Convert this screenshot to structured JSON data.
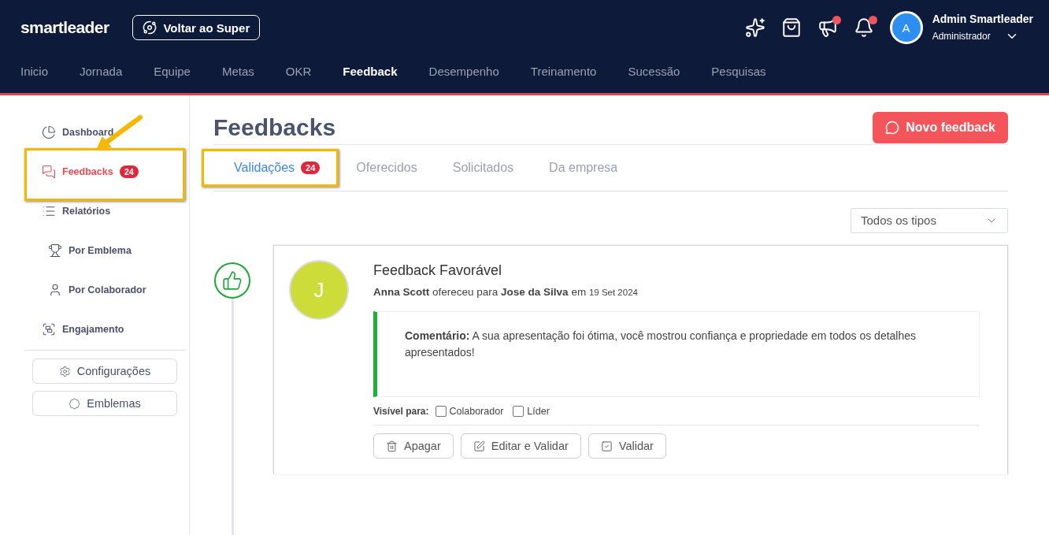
{
  "brand": "smartleader",
  "back_button": "Voltar ao Super",
  "header_icons": [
    {
      "kind": "sparkles",
      "dot": false
    },
    {
      "kind": "bag",
      "dot": false
    },
    {
      "kind": "megaphone",
      "dot": true
    },
    {
      "kind": "bell",
      "dot": true
    }
  ],
  "user": {
    "initial": "A",
    "name": "Admin Smartleader",
    "role": "Administrador"
  },
  "nav": [
    {
      "label": "Inicio",
      "selected": false
    },
    {
      "label": "Jornada",
      "selected": false
    },
    {
      "label": "Equipe",
      "selected": false
    },
    {
      "label": "Metas",
      "selected": false
    },
    {
      "label": "OKR",
      "selected": false
    },
    {
      "label": "Feedback",
      "selected": true
    },
    {
      "label": "Desempenho",
      "selected": false
    },
    {
      "label": "Treinamento",
      "selected": false
    },
    {
      "label": "Sucessão",
      "selected": false
    },
    {
      "label": "Pesquisas",
      "selected": false
    }
  ],
  "sidebar": {
    "items": [
      {
        "kind": "dashboard",
        "label": "Dashboard",
        "selected": false
      },
      {
        "kind": "feedbacks",
        "label": "Feedbacks",
        "badge": "24",
        "selected": true
      },
      {
        "kind": "reports",
        "label": "Relatórios",
        "selected": false,
        "children": [
          {
            "kind": "trophy",
            "label": "Por Emblema",
            "selected": false
          },
          {
            "kind": "person",
            "label": "Por Colaborador",
            "selected": false
          }
        ]
      },
      {
        "kind": "engagement",
        "label": "Engajamento",
        "selected": false
      }
    ],
    "buttons": [
      {
        "kind": "gear",
        "label": "Configurações"
      },
      {
        "kind": "emblem",
        "label": "Emblemas"
      }
    ]
  },
  "page_title": "Feedbacks",
  "new_button": "Novo feedback",
  "tabs": [
    {
      "label": "Validações",
      "badge": "24",
      "selected": true
    },
    {
      "label": "Oferecidos",
      "selected": false
    },
    {
      "label": "Solicitados",
      "selected": false
    },
    {
      "label": "Da empresa",
      "selected": false
    }
  ],
  "filter": {
    "value": "Todos os tipos"
  },
  "feedbacks": [
    {
      "kind": "positive",
      "initial": "J",
      "title": "Feedback Favorável",
      "byline": "**Anna Scott** ofereceu para **Jose da Silva** em",
      "date": "19 Set 2024",
      "comment": "**Comentário:** A sua apresentação foi ótima, você mostrou confiança e propriedade em todos os detalhes apresentados!",
      "visible_label": "Visível para:",
      "visible_options": [
        {
          "label": "Colaborador",
          "checked": false
        },
        {
          "label": "Líder",
          "checked": false
        }
      ],
      "actions": [
        {
          "kind": "delete",
          "label": "Apagar"
        },
        {
          "kind": "edit",
          "label": "Editar e Validar"
        },
        {
          "kind": "validate",
          "label": "Validar"
        }
      ]
    }
  ]
}
